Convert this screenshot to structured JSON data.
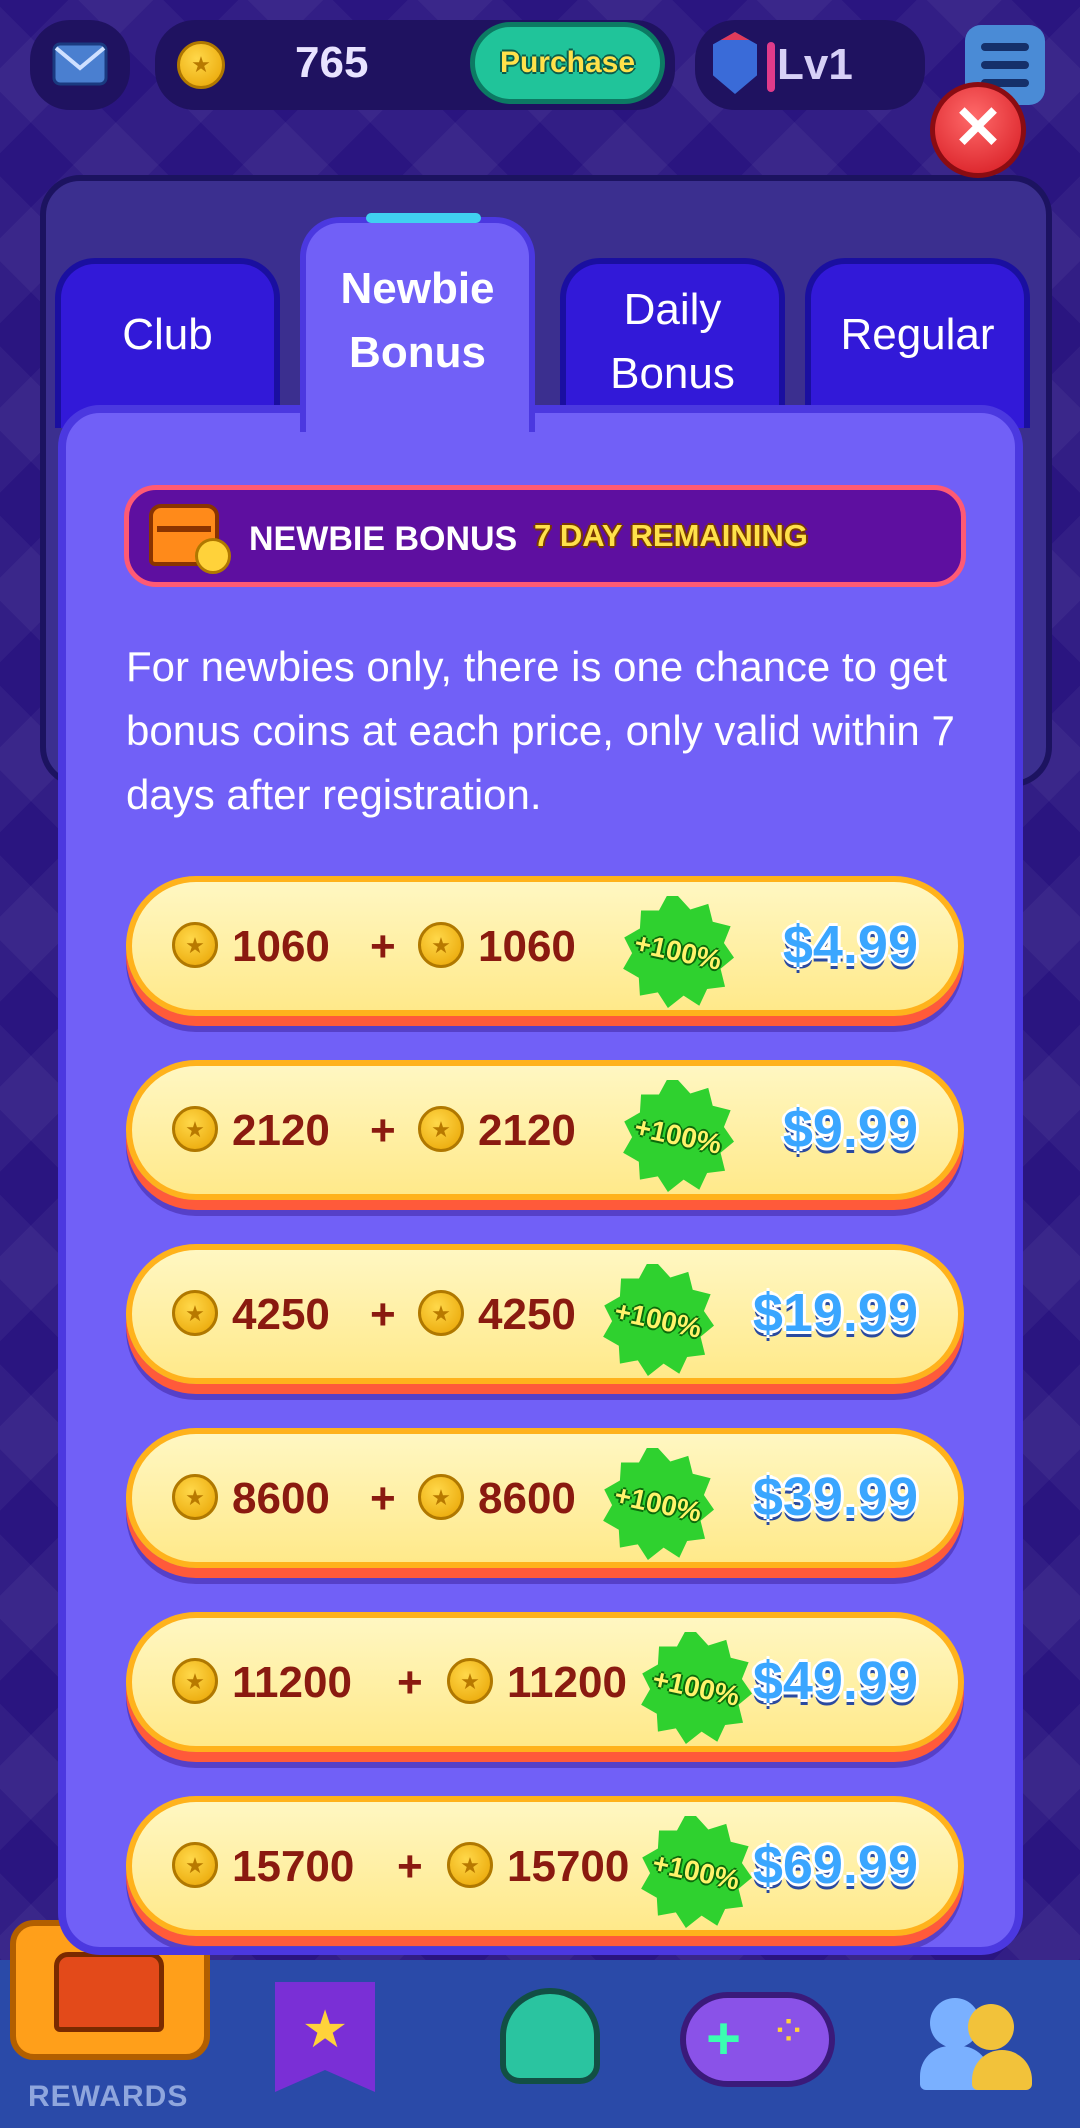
{
  "topbar": {
    "icons": {
      "mail": "mail-icon",
      "coin": "coin-icon",
      "level": "level-badge-icon",
      "menu": "menu-list-icon"
    },
    "coin_count": "765",
    "purchase_label": "Purchase",
    "level_label": "Lv1"
  },
  "close_icon": "✕",
  "tabs": [
    {
      "label": "Club",
      "active": false
    },
    {
      "label": "Newbie Bonus",
      "active": true
    },
    {
      "label": "Daily Bonus",
      "active": false
    },
    {
      "label": "Regular",
      "active": false
    }
  ],
  "banner": {
    "title": "NEWBIE BONUS",
    "remaining": "7 DAY REMAINING"
  },
  "description": "For newbies only, there is one chance to get bonus coins at each price, only valid within 7 days after registration.",
  "offers": [
    {
      "base": "1060",
      "plus": "+",
      "bonus": "1060",
      "badge": "+100%",
      "price": "$4.99"
    },
    {
      "base": "2120",
      "plus": "+",
      "bonus": "2120",
      "badge": "+100%",
      "price": "$9.99"
    },
    {
      "base": "4250",
      "plus": "+",
      "bonus": "4250",
      "badge": "+100%",
      "price": "$19.99"
    },
    {
      "base": "8600",
      "plus": "+",
      "bonus": "8600",
      "badge": "+100%",
      "price": "$39.99"
    },
    {
      "base": "11200",
      "plus": "+",
      "bonus": "11200",
      "badge": "+100%",
      "price": "$49.99"
    },
    {
      "base": "15700",
      "plus": "+",
      "bonus": "15700",
      "badge": "+100%",
      "price": "$69.99"
    }
  ],
  "bottom_nav": {
    "rewards_label": "REWARDS",
    "icons": [
      "treasure-chest-icon",
      "star-banner-icon",
      "character-hat-icon",
      "gamepad-icon",
      "friends-icon"
    ]
  },
  "colors": {
    "accent_purple": "#7160f7",
    "tab_blue": "#3219d8",
    "coin_gold": "#ffd23a",
    "price_blue": "#3aa6ff",
    "badge_green": "#2fd12f",
    "close_red": "#d4161e"
  }
}
